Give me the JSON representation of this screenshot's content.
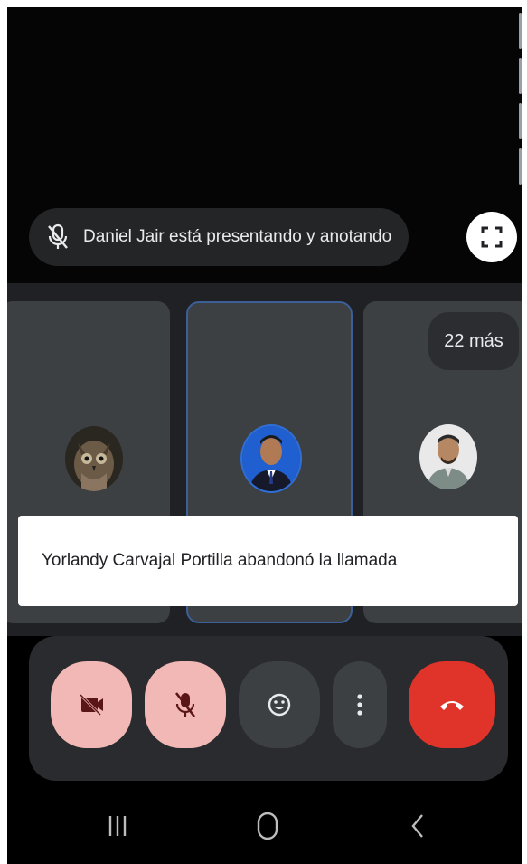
{
  "presentation": {
    "presenter_text": "Daniel Jair está presentando y anotando",
    "mic_icon": "mic-off-icon",
    "fullscreen_icon": "fullscreen-icon"
  },
  "participants": {
    "more_count_label": "22 más",
    "tiles": [
      {
        "avatar": "owl-avatar-photo"
      },
      {
        "avatar": "man-suit-avatar-photo",
        "highlighted": true
      },
      {
        "avatar": "man-avatar-photo"
      }
    ]
  },
  "toast": {
    "message": "Yorlandy Carvajal Portilla abandonó la llamada"
  },
  "controls": {
    "camera": {
      "icon": "video-off-icon",
      "state": "off"
    },
    "microphone": {
      "icon": "mic-off-icon",
      "state": "off"
    },
    "reactions": {
      "icon": "emoji-icon"
    },
    "more": {
      "icon": "more-vertical-icon"
    },
    "end_call": {
      "icon": "hang-up-icon"
    }
  },
  "system_nav": {
    "recents": "recents-icon",
    "home": "home-icon",
    "back": "back-icon"
  },
  "colors": {
    "muted_button": "#f2b8b5",
    "end_call": "#e0342a",
    "active_speaker_border": "#3b5f96"
  }
}
